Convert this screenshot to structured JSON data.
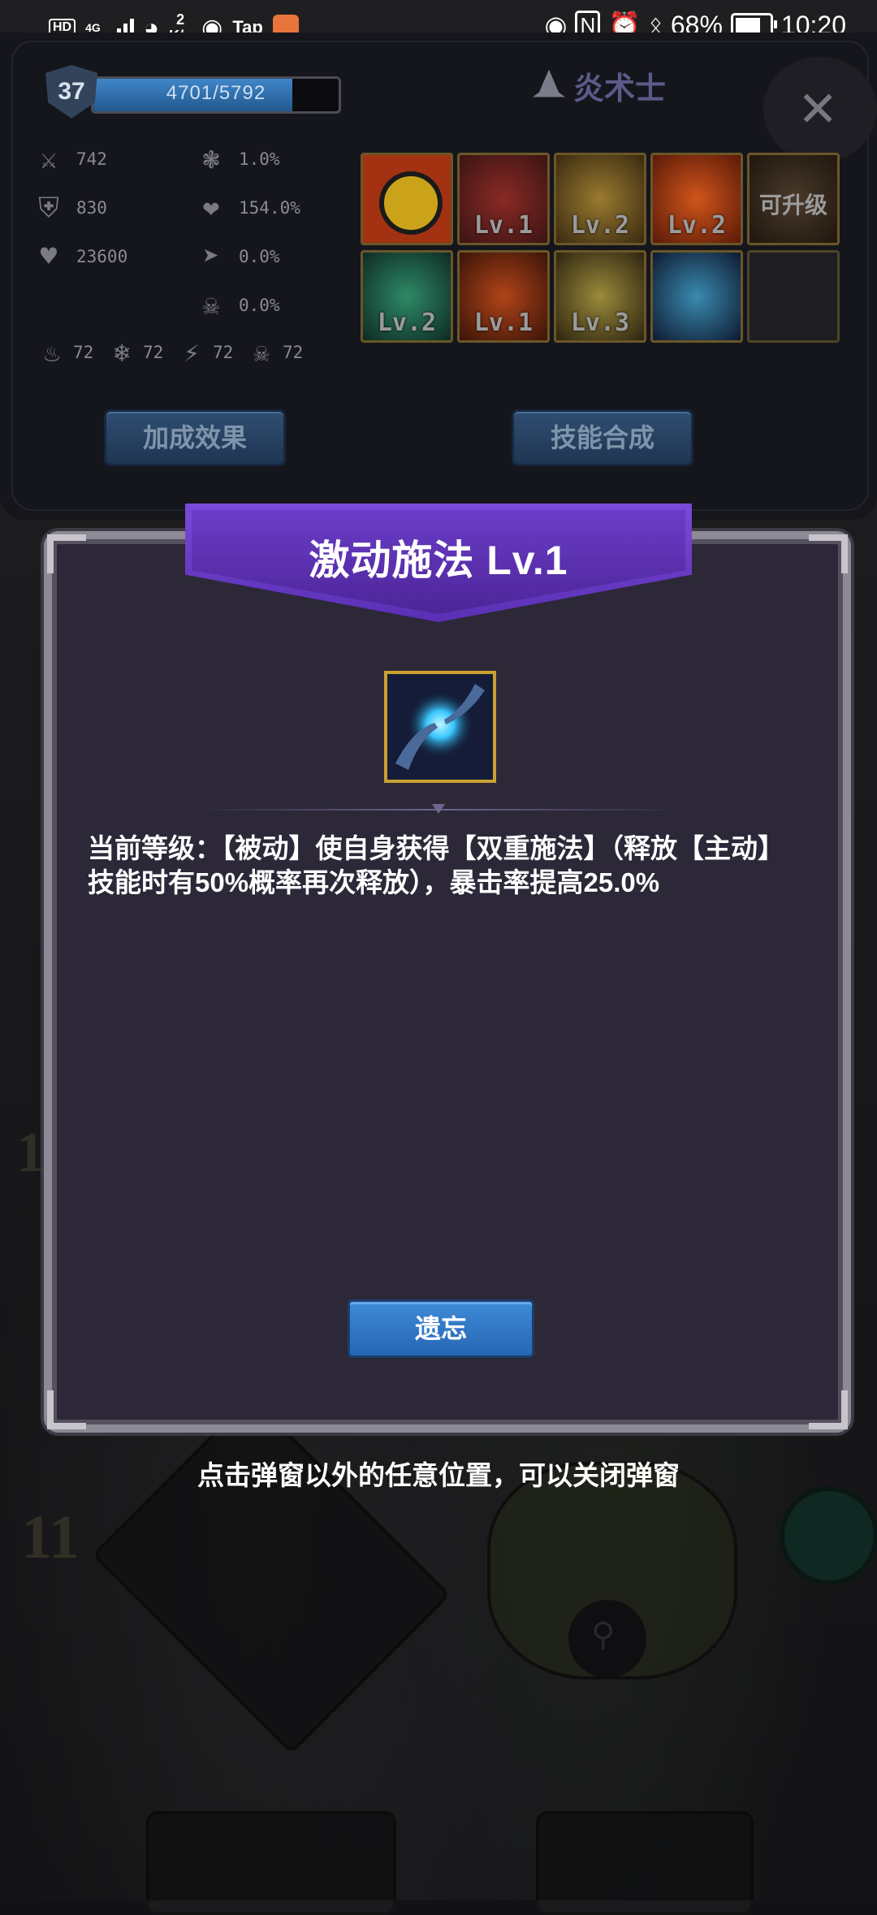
{
  "status_bar": {
    "hd_label": "HD",
    "network": "4G",
    "net_speed_value": "2",
    "net_speed_unit": "K/s",
    "tap_label": "Tap",
    "battery": "68%",
    "time": "10:20"
  },
  "character": {
    "level": "37",
    "xp_text": "4701/5792",
    "xp_fraction": 0.81,
    "class_name": "炎术士",
    "close_label": "✕",
    "stats_left": [
      {
        "icon": "sword-icon",
        "value": "742"
      },
      {
        "icon": "shield-icon",
        "value": "830"
      },
      {
        "icon": "heart-icon",
        "value": "23600"
      }
    ],
    "stats_right": [
      {
        "icon": "crit-burst-icon",
        "value": "1.0%"
      },
      {
        "icon": "broken-heart-icon",
        "value": "154.0%"
      },
      {
        "icon": "boot-icon",
        "value": "0.0%"
      },
      {
        "icon": "skull-icon",
        "value": "0.0%"
      }
    ],
    "elements": [
      {
        "icon": "fire-icon",
        "value": "72"
      },
      {
        "icon": "snowflake-icon",
        "value": "72"
      },
      {
        "icon": "lightning-icon",
        "value": "72"
      },
      {
        "icon": "skull-crossbones-icon",
        "value": "72"
      }
    ],
    "skills": [
      {
        "label": "",
        "color": "#a23212"
      },
      {
        "label": "Lv.1",
        "color": "#5a2020"
      },
      {
        "label": "Lv.2",
        "color": "#5c4418"
      },
      {
        "label": "Lv.2",
        "color": "#7a2a10"
      },
      {
        "label": "可升级",
        "color": "#3a2a1a"
      },
      {
        "label": "Lv.2",
        "color": "#1c4a3a"
      },
      {
        "label": "Lv.1",
        "color": "#6a2c12"
      },
      {
        "label": "Lv.3",
        "color": "#5a4a1a"
      },
      {
        "label": "",
        "color": "#1f3a5a"
      },
      {
        "label": "",
        "color": "#1e1e22"
      }
    ],
    "buttons": {
      "bonus_effect": "加成效果",
      "skill_fusion": "技能合成"
    }
  },
  "dialog": {
    "title": "激动施法 Lv.1",
    "description": "当前等级：【被动】使自身获得【双重施法】（释放【主动】技能时有50%概率再次释放），暴击率提高25.0%",
    "forget_button": "遗忘",
    "close_hint": "点击弹窗以外的任意位置，可以关闭弹窗"
  },
  "background": {
    "left_number_top": "1",
    "left_number_bottom": "11"
  },
  "colors": {
    "ribbon": "#6a3dc8",
    "dialog_bg": "#2c2838",
    "button_blue": "#2f77c4",
    "panel_bg": "#15151c"
  }
}
